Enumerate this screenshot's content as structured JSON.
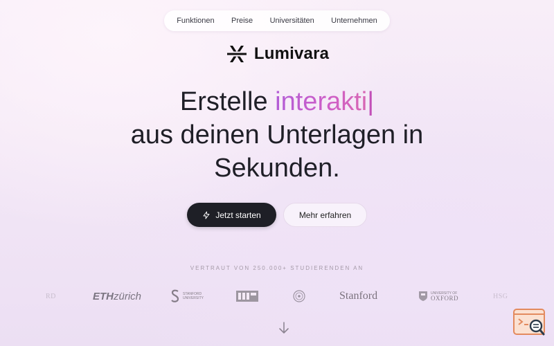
{
  "nav": {
    "items": [
      {
        "label": "Funktionen"
      },
      {
        "label": "Preise"
      },
      {
        "label": "Universitäten"
      },
      {
        "label": "Unternehmen"
      }
    ]
  },
  "brand": {
    "name": "Lumivara"
  },
  "hero": {
    "line1_prefix": "Erstelle ",
    "line1_typed": "interakti",
    "caret": "|",
    "line2": "aus deinen Unterlagen in",
    "line3": "Sekunden."
  },
  "cta": {
    "primary_label": "Jetzt starten",
    "secondary_label": "Mehr erfahren"
  },
  "trusted": {
    "label": "VERTRAUT VON 250.000+ STUDIERENDEN AN",
    "logos": [
      {
        "text": "RD",
        "icon": "partial-logo"
      },
      {
        "text": "ETH",
        "text2": "zürich",
        "icon": "eth-logo"
      },
      {
        "text": "STANFORD",
        "text2": "UNIVERSITY",
        "icon": "stanford-s-logo"
      },
      {
        "text": "",
        "icon": "tum-logo"
      },
      {
        "text": "",
        "icon": "seal-logo"
      },
      {
        "text": "Stanford",
        "icon": "stanford-wordmark"
      },
      {
        "text": "UNIVERSITY OF",
        "text2": "OXFORD",
        "icon": "oxford-crest"
      },
      {
        "text": "HSG",
        "icon": "partial-logo"
      }
    ]
  },
  "colors": {
    "accent_start": "#b25bd6",
    "accent_end": "#d767b3",
    "primary_button": "#1e1f26",
    "fab_border": "#e38a5e"
  },
  "icons": {
    "primary_button_icon": "bolt-icon",
    "scroll_icon": "arrow-down-icon",
    "fab_icon": "search-magnifier-icon"
  }
}
